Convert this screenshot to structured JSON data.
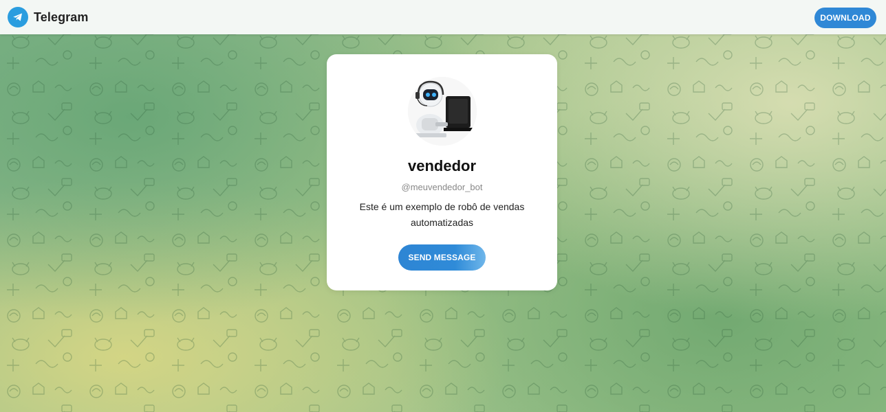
{
  "header": {
    "app_name": "Telegram",
    "download_label": "DOWNLOAD"
  },
  "card": {
    "name": "vendedor",
    "username": "@meuvendedor_bot",
    "description": "Este é um exemplo de robô de vendas automatizadas",
    "send_label": "SEND MESSAGE"
  },
  "colors": {
    "brand_blue": "#2a9ddf",
    "button_blue": "#2f88d6"
  },
  "icons": {
    "logo": "telegram-logo-icon",
    "avatar": "robot-avatar-image"
  }
}
